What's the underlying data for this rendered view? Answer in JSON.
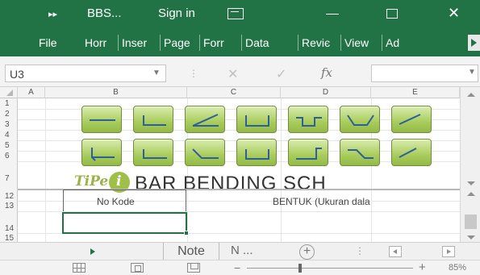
{
  "titlebar": {
    "quick_access": "▸▸",
    "document_name": "BBS...",
    "sign_in": "Sign in",
    "close": "✕"
  },
  "ribbon_tabs": [
    "File",
    "Horr",
    "Inser",
    "Page",
    "Forr",
    "Data",
    "Reviє",
    "View",
    "Ad"
  ],
  "formula_bar": {
    "name_box": "U3",
    "cancel_symbol": "✕",
    "enter_symbol": "✓",
    "fx_label": "fx",
    "formula": ""
  },
  "columns": [
    "A",
    "B",
    "C",
    "D",
    "E"
  ],
  "rows": [
    "1",
    "2",
    "3",
    "4",
    "5",
    "6",
    "7",
    "12",
    "13",
    "14",
    "15"
  ],
  "sheet": {
    "logo_text": "TiPe",
    "schedule_title": "BAR BENDING SCH",
    "header_no_kode": "No Kode",
    "header_bentuk": "BENTUK (Ukuran dala"
  },
  "shape_buttons": [
    {
      "shape": "straight-bar"
    },
    {
      "shape": "l-hook"
    },
    {
      "shape": "diagonal-bent"
    },
    {
      "shape": "u-shape"
    },
    {
      "shape": "offset-up"
    },
    {
      "shape": "trapezoid"
    },
    {
      "shape": "diagonal-partial"
    },
    {
      "shape": "u-left-hook"
    },
    {
      "shape": "l-bar"
    },
    {
      "shape": "crank"
    },
    {
      "shape": "u-deep"
    },
    {
      "shape": "offset-right"
    },
    {
      "shape": "z-bend"
    },
    {
      "shape": "cut-partial"
    }
  ],
  "sheet_tabs": {
    "active": "Note",
    "more": "N ...",
    "add": "+"
  },
  "status_bar": {
    "zoom_minus": "−",
    "zoom_plus": "+",
    "zoom_level": "85%",
    "zoom_value": 0.85
  },
  "colors": {
    "excel_green": "#217346",
    "button_green": "#a9cd5c",
    "shape_stroke": "#2f5f9a",
    "logo_green": "#9fbf48"
  }
}
